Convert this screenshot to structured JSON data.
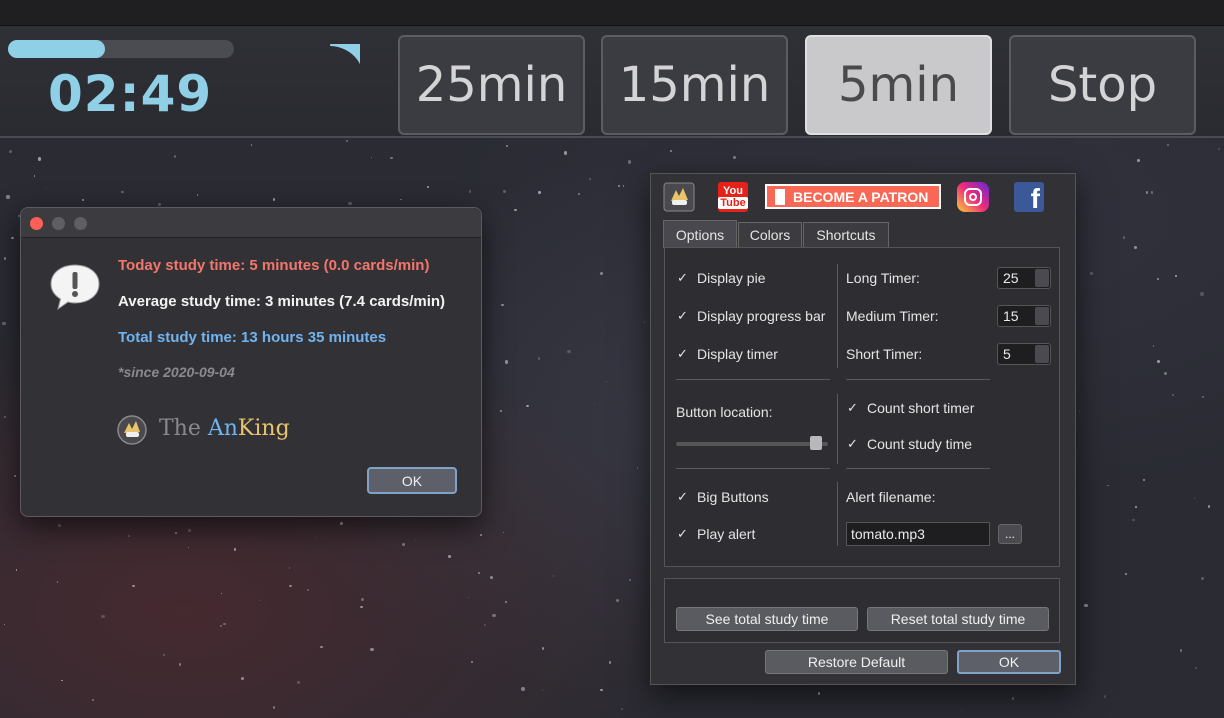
{
  "timer": {
    "progress_fraction": 0.43,
    "time_remaining": "02:49",
    "pie_fraction": 0.3,
    "buttons": [
      {
        "label": "25min",
        "active": false
      },
      {
        "label": "15min",
        "active": false
      },
      {
        "label": "5min",
        "active": true
      },
      {
        "label": "Stop",
        "active": false
      }
    ]
  },
  "stats_dialog": {
    "today": "Today study time: 5 minutes (0.0 cards/min)",
    "average": "Average study time: 3 minutes (7.4 cards/min)",
    "total": "Total study time: 13 hours 35 minutes",
    "since": "*since 2020-09-04",
    "brand_text_the": "The ",
    "brand_text_an": "An",
    "brand_text_king": "King",
    "ok_label": "OK",
    "colors": {
      "today": "#f2766b",
      "average": "#f2f2f2",
      "total": "#6fb3f0"
    }
  },
  "options_window": {
    "social": {
      "youtube_you": "You",
      "youtube_tube": "Tube",
      "patron_label": "BECOME A PATRON",
      "facebook_glyph": "f"
    },
    "tabs": [
      "Options",
      "Colors",
      "Shortcuts"
    ],
    "active_tab": "Options",
    "check_glyph": "✓",
    "display": {
      "pie": "Display pie",
      "progress_bar": "Display progress bar",
      "timer": "Display timer"
    },
    "timers": {
      "long_label": "Long Timer:",
      "long_value": "25",
      "medium_label": "Medium Timer:",
      "medium_value": "15",
      "short_label": "Short Timer:",
      "short_value": "5"
    },
    "button_location_label": "Button location:",
    "button_location_value": 0.92,
    "count_short_timer": "Count short timer",
    "count_study_time": "Count study time",
    "big_buttons": "Big Buttons",
    "play_alert": "Play alert",
    "alert_filename_label": "Alert filename:",
    "alert_filename_value": "tomato.mp3",
    "browse_label": "...",
    "see_total": "See total study time",
    "reset_total": "Reset total study time",
    "restore_default": "Restore Default",
    "ok_label": "OK"
  }
}
